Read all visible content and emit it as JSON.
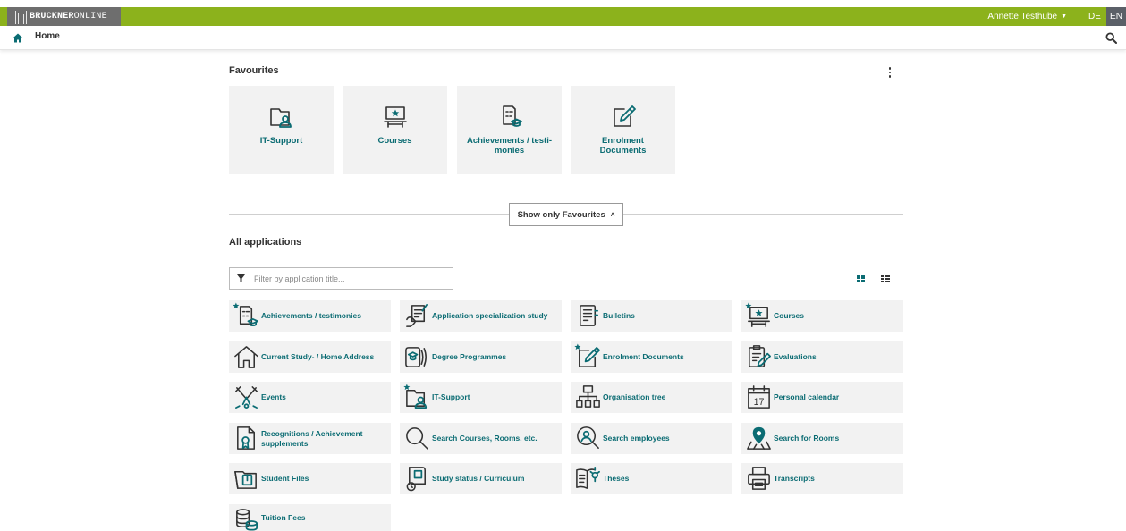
{
  "topbar": {
    "logo_bold": "BRUCKNER",
    "logo_light": "ONLINE",
    "user_name": "Annette Testhube",
    "lang_de": "DE",
    "lang_en": "EN"
  },
  "navbar": {
    "home_label": "Home"
  },
  "favourites": {
    "title": "Favourites",
    "tiles": [
      {
        "label": "IT-Support",
        "icon": "it-support-icon"
      },
      {
        "label": "Courses",
        "icon": "courses-icon"
      },
      {
        "label": "Achievements / testi-\nmonies",
        "icon": "achievements-icon"
      },
      {
        "label": "Enrolment Documents",
        "icon": "enrolment-documents-icon"
      }
    ]
  },
  "toggle": {
    "show_only_favourites": "Show only Favourites"
  },
  "all_apps": {
    "title": "All applications",
    "filter_placeholder": "Filter by application title...",
    "items": [
      {
        "label": "Achievements / testimonies",
        "icon": "achievements-icon",
        "favourite": true
      },
      {
        "label": "Application specialization study",
        "icon": "application-hand-icon",
        "favourite": false
      },
      {
        "label": "Bulletins",
        "icon": "bulletins-icon",
        "favourite": false
      },
      {
        "label": "Courses",
        "icon": "courses-icon",
        "favourite": true
      },
      {
        "label": "Current Study- / Home Address",
        "icon": "house-icon",
        "favourite": false
      },
      {
        "label": "Degree Programmes",
        "icon": "degree-programmes-icon",
        "favourite": false
      },
      {
        "label": "Enrolment Documents",
        "icon": "enrolment-documents-icon",
        "favourite": true
      },
      {
        "label": "Evaluations",
        "icon": "evaluations-icon",
        "favourite": false
      },
      {
        "label": "Events",
        "icon": "events-icon",
        "favourite": false
      },
      {
        "label": "IT-Support",
        "icon": "it-support-icon",
        "favourite": true
      },
      {
        "label": "Organisation tree",
        "icon": "organisation-tree-icon",
        "favourite": false
      },
      {
        "label": "Personal calendar",
        "icon": "calendar-icon",
        "favourite": false
      },
      {
        "label": "Recognitions / Achievement supplements",
        "icon": "recognitions-icon",
        "favourite": false
      },
      {
        "label": "Search Courses, Rooms, etc.",
        "icon": "magnifier-icon",
        "favourite": false
      },
      {
        "label": "Search employees",
        "icon": "search-employees-icon",
        "favourite": false
      },
      {
        "label": "Search for Rooms",
        "icon": "map-pin-icon",
        "favourite": false
      },
      {
        "label": "Student Files",
        "icon": "student-files-icon",
        "favourite": false
      },
      {
        "label": "Study status / Curriculum",
        "icon": "study-status-icon",
        "favourite": false
      },
      {
        "label": "Theses",
        "icon": "theses-icon",
        "favourite": false
      },
      {
        "label": "Transcripts",
        "icon": "printer-icon",
        "favourite": false
      },
      {
        "label": "Tuition Fees",
        "icon": "coins-icon",
        "favourite": false
      }
    ]
  },
  "calendar_day": "17",
  "colors": {
    "topbar": "#8cb21c",
    "accent": "#0b6c73",
    "tile_bg": "#f2f2f2"
  }
}
